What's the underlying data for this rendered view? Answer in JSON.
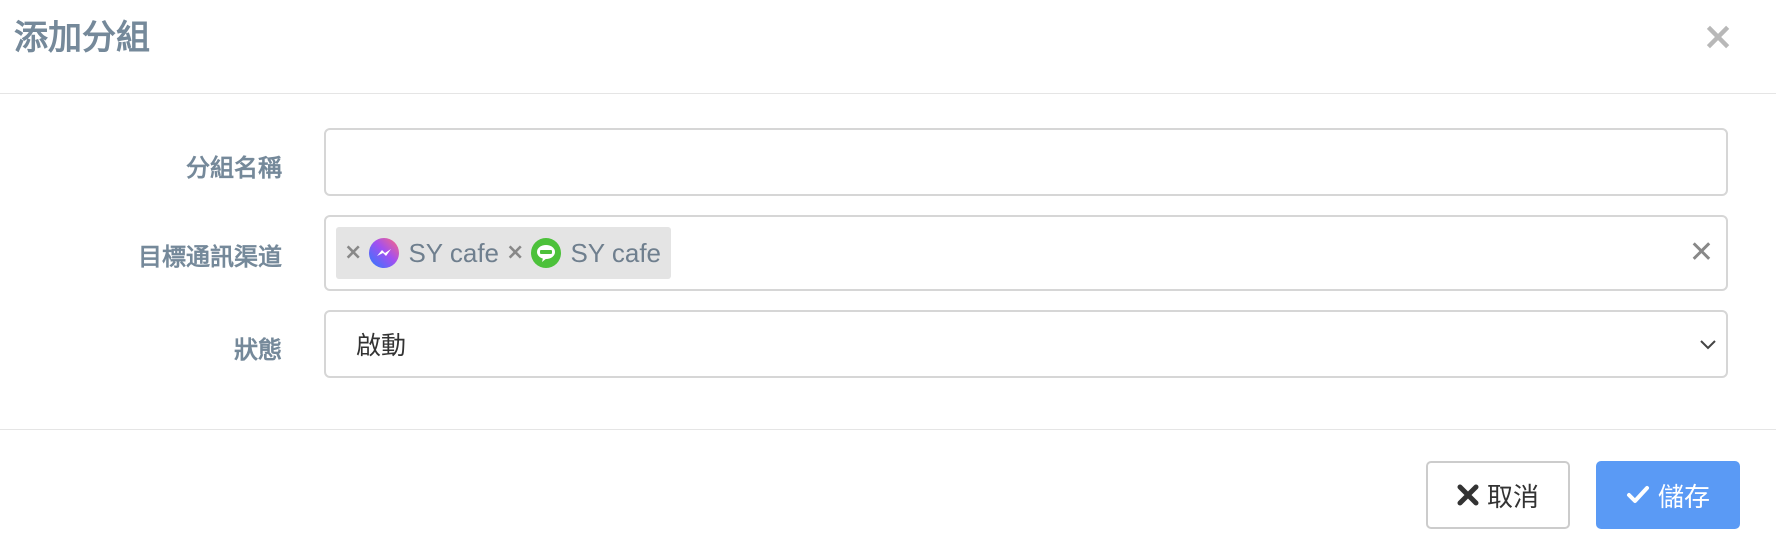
{
  "dialog": {
    "title": "添加分組",
    "close_symbol": "×"
  },
  "form": {
    "group_name": {
      "label": "分組名稱",
      "value": ""
    },
    "channels": {
      "label": "目標通訊渠道",
      "tags": [
        {
          "remove_symbol": "×",
          "icon": "messenger-icon",
          "text": "SY cafe",
          "color": "#a34ff0"
        },
        {
          "remove_symbol": "×",
          "icon": "line-icon",
          "text": "SY cafe",
          "color": "#4cc13a"
        }
      ],
      "clear_symbol": "✕"
    },
    "status": {
      "label": "狀態",
      "value": "啟動"
    }
  },
  "footer": {
    "cancel_label": "取消",
    "save_label": "儲存"
  },
  "colors": {
    "label_text": "#75899a",
    "primary": "#5a9af5",
    "tag_bg": "#e4e4e4"
  }
}
